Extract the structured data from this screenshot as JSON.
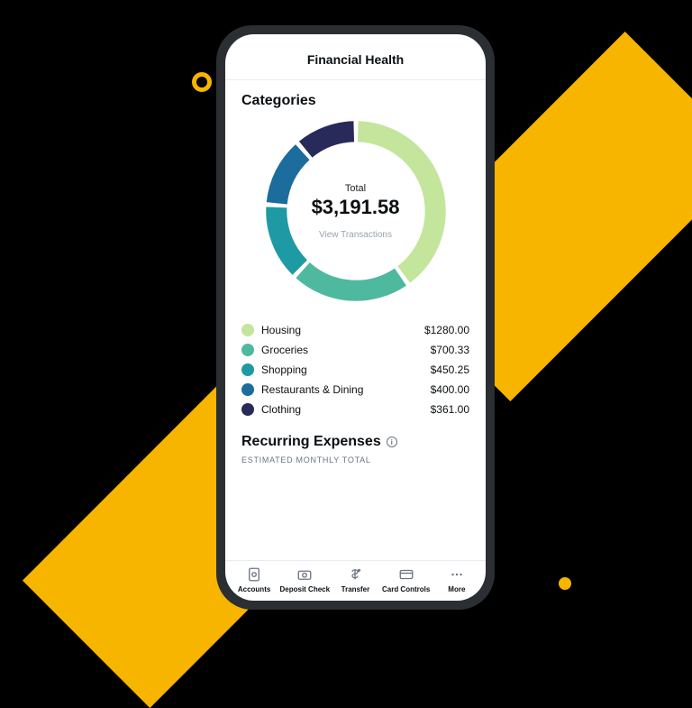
{
  "header": {
    "title": "Financial Health"
  },
  "categories": {
    "title": "Categories",
    "total_label": "Total",
    "total_value": "$3,191.58",
    "link": "View Transactions",
    "items": [
      {
        "label": "Housing",
        "value": "$1280.00",
        "color": "#C4E59C"
      },
      {
        "label": "Groceries",
        "value": "$700.33",
        "color": "#4FB99F"
      },
      {
        "label": "Shopping",
        "value": "$450.25",
        "color": "#1E9AA4"
      },
      {
        "label": "Restaurants & Dining",
        "value": "$400.00",
        "color": "#1C6C9E"
      },
      {
        "label": "Clothing",
        "value": "$361.00",
        "color": "#282A59"
      }
    ]
  },
  "recurring": {
    "title": "Recurring Expenses",
    "subtitle": "ESTIMATED MONTHLY TOTAL"
  },
  "tabs": [
    {
      "label": "Accounts",
      "icon": "accounts-icon"
    },
    {
      "label": "Deposit Check",
      "icon": "deposit-check-icon"
    },
    {
      "label": "Transfer",
      "icon": "transfer-icon"
    },
    {
      "label": "Card Controls",
      "icon": "card-controls-icon"
    },
    {
      "label": "More",
      "icon": "more-icon"
    }
  ],
  "chart_data": {
    "type": "pie",
    "title": "Categories",
    "total": 3191.58,
    "series": [
      {
        "name": "Housing",
        "value": 1280.0,
        "color": "#C4E59C"
      },
      {
        "name": "Groceries",
        "value": 700.33,
        "color": "#4FB99F"
      },
      {
        "name": "Shopping",
        "value": 450.25,
        "color": "#1E9AA4"
      },
      {
        "name": "Restaurants & Dining",
        "value": 400.0,
        "color": "#1C6C9E"
      },
      {
        "name": "Clothing",
        "value": 361.0,
        "color": "#282A59"
      }
    ]
  }
}
